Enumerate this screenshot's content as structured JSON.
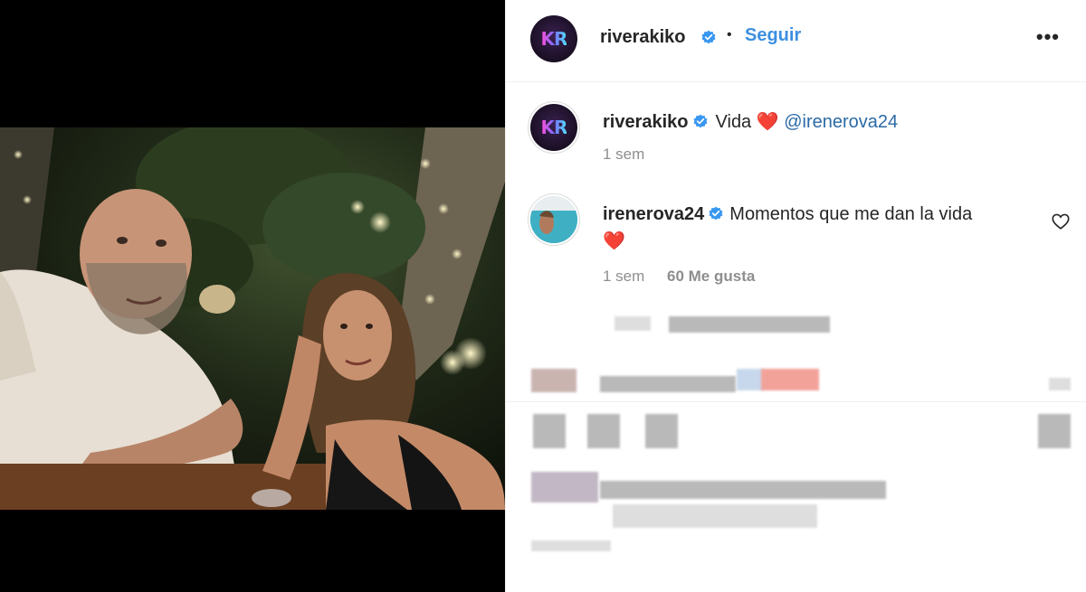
{
  "post": {
    "author": "riverakiko",
    "avatar_text": "KR",
    "follow_label": "Seguir",
    "separator": "•",
    "more_icon": "•••"
  },
  "comments": [
    {
      "username": "riverakiko",
      "avatar_text": "KR",
      "text": "Vida",
      "emoji": "❤️",
      "mention": "@irenerova24",
      "time": "1 sem"
    },
    {
      "username": "irenerova24",
      "text": "Momentos que me dan la vida",
      "emoji": "❤️",
      "time": "1 sem",
      "likes": "60 Me gusta"
    }
  ],
  "colors": {
    "accent": "#3d8fe0",
    "mention": "#2b6aa6",
    "verified": "#3897f0",
    "heart": "#e11d2e",
    "muted": "#8e8e8e"
  }
}
